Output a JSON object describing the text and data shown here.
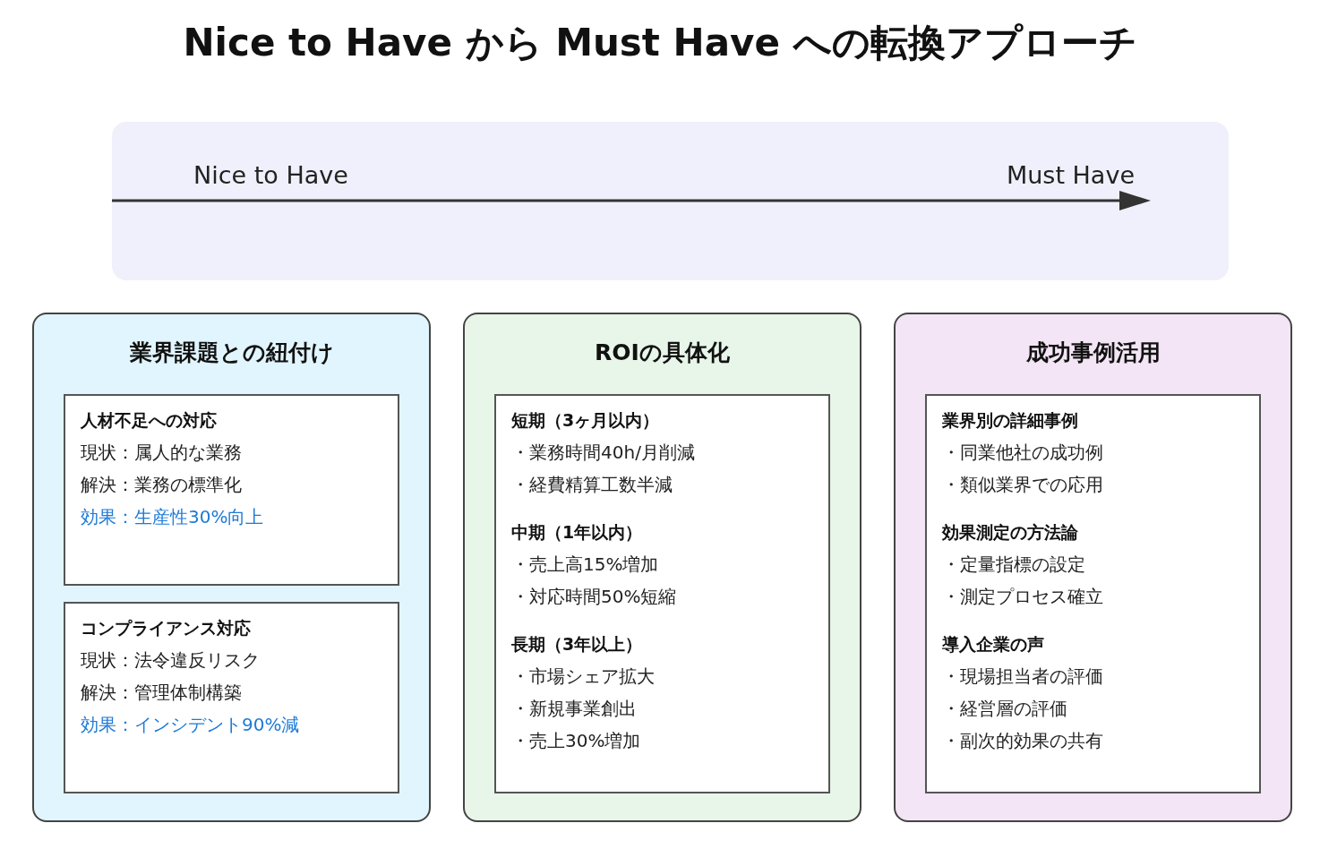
{
  "title": "Nice to Have から Must Have への転換アプローチ",
  "scale": {
    "start_label": "Nice to Have",
    "end_label": "Must Have"
  },
  "columns": [
    {
      "title": "業界課題との紐付け",
      "color": "#e1f5fe",
      "boxes": [
        {
          "sections": [
            {
              "heading": "人材不足への対応",
              "lines": [
                {
                  "text": "現状：属人的な業務",
                  "kind": "normal"
                },
                {
                  "text": "解決：業務の標準化",
                  "kind": "normal"
                },
                {
                  "text": "効果：生産性30%向上",
                  "kind": "highlight"
                }
              ]
            }
          ]
        },
        {
          "sections": [
            {
              "heading": "コンプライアンス対応",
              "lines": [
                {
                  "text": "現状：法令違反リスク",
                  "kind": "normal"
                },
                {
                  "text": "解決：管理体制構築",
                  "kind": "normal"
                },
                {
                  "text": "効果：インシデント90%減",
                  "kind": "highlight"
                }
              ]
            }
          ]
        }
      ]
    },
    {
      "title": "ROIの具体化",
      "color": "#e8f5e9",
      "boxes": [
        {
          "sections": [
            {
              "heading": "短期（3ヶ月以内）",
              "lines": [
                {
                  "text": "・業務時間40h/月削減",
                  "kind": "normal"
                },
                {
                  "text": "・経費精算工数半減",
                  "kind": "normal"
                }
              ]
            },
            {
              "heading": "中期（1年以内）",
              "lines": [
                {
                  "text": "・売上高15%増加",
                  "kind": "normal"
                },
                {
                  "text": "・対応時間50%短縮",
                  "kind": "normal"
                }
              ]
            },
            {
              "heading": "長期（3年以上）",
              "lines": [
                {
                  "text": "・市場シェア拡大",
                  "kind": "normal"
                },
                {
                  "text": "・新規事業創出",
                  "kind": "normal"
                },
                {
                  "text": "・売上30%増加",
                  "kind": "normal"
                }
              ]
            }
          ]
        }
      ]
    },
    {
      "title": "成功事例活用",
      "color": "#f3e5f5",
      "boxes": [
        {
          "sections": [
            {
              "heading": "業界別の詳細事例",
              "lines": [
                {
                  "text": "・同業他社の成功例",
                  "kind": "normal"
                },
                {
                  "text": "・類似業界での応用",
                  "kind": "normal"
                }
              ]
            },
            {
              "heading": "効果測定の方法論",
              "lines": [
                {
                  "text": "・定量指標の設定",
                  "kind": "normal"
                },
                {
                  "text": "・測定プロセス確立",
                  "kind": "normal"
                }
              ]
            },
            {
              "heading": "導入企業の声",
              "lines": [
                {
                  "text": "・現場担当者の評価",
                  "kind": "normal"
                },
                {
                  "text": "・経営層の評価",
                  "kind": "normal"
                },
                {
                  "text": "・副次的効果の共有",
                  "kind": "normal"
                }
              ]
            }
          ]
        }
      ]
    }
  ]
}
